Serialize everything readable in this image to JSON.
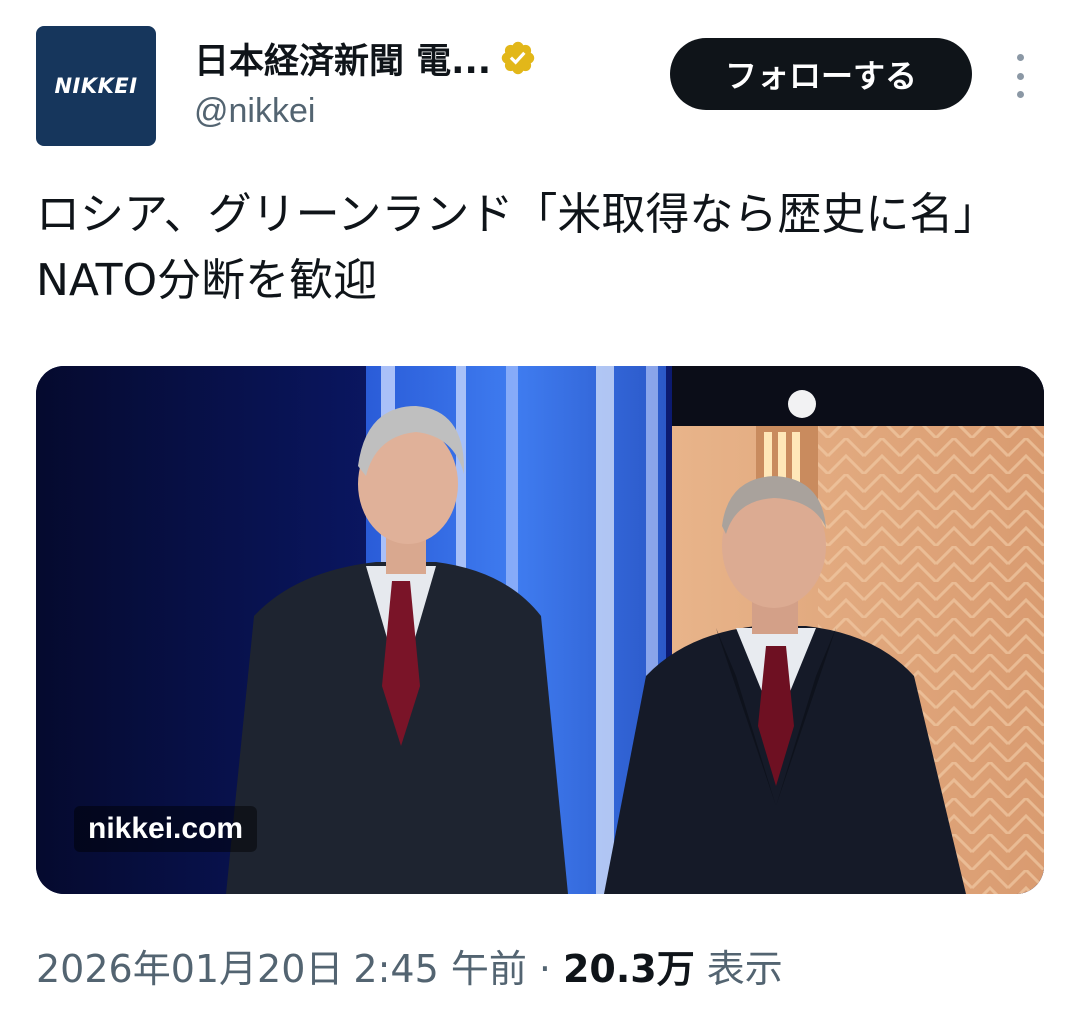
{
  "account": {
    "avatar_text": "NIKKEI",
    "display_name": "日本経済新聞 電...",
    "handle": "@nikkei",
    "verified": true,
    "verified_badge_color": "#e2b719"
  },
  "actions": {
    "follow_label": "フォローする",
    "more_icon": "more-vertical-icon"
  },
  "tweet": {
    "text": "ロシア、グリーンランド「米取得なら歴史に名」　NATO分断を歓迎"
  },
  "media": {
    "source_label": "nikkei.com"
  },
  "meta": {
    "date": "2026年01月20日",
    "time": "2:45 午前",
    "separator": "·",
    "views_count": "20.3万",
    "views_label": "表示"
  },
  "colors": {
    "primary_text": "#0f1419",
    "secondary_text": "#536471",
    "follow_button_bg": "#0f1419",
    "avatar_bg": "#16365c"
  }
}
